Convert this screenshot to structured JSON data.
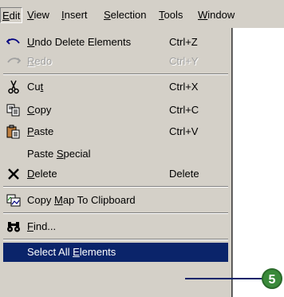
{
  "menubar": {
    "items": [
      {
        "pre": "",
        "u": "E",
        "post": "dit"
      },
      {
        "pre": "",
        "u": "V",
        "post": "iew"
      },
      {
        "pre": "",
        "u": "I",
        "post": "nsert"
      },
      {
        "pre": "",
        "u": "S",
        "post": "election"
      },
      {
        "pre": "",
        "u": "T",
        "post": "ools"
      },
      {
        "pre": "",
        "u": "W",
        "post": "indow"
      }
    ]
  },
  "menu": {
    "items": [
      {
        "icon": "undo-icon",
        "pre": "",
        "u": "U",
        "post": "ndo Delete Elements",
        "shortcut": "Ctrl+Z"
      },
      {
        "icon": "redo-icon",
        "pre": "",
        "u": "R",
        "post": "edo",
        "shortcut": "Ctrl+Y"
      },
      {
        "icon": "scissors-icon",
        "pre": "Cu",
        "u": "t",
        "post": "",
        "shortcut": "Ctrl+X"
      },
      {
        "icon": "copy-icon",
        "pre": "",
        "u": "C",
        "post": "opy",
        "shortcut": "Ctrl+C"
      },
      {
        "icon": "paste-icon",
        "pre": "",
        "u": "P",
        "post": "aste",
        "shortcut": "Ctrl+V"
      },
      {
        "icon": "",
        "pre": "Paste ",
        "u": "S",
        "post": "pecial",
        "shortcut": ""
      },
      {
        "icon": "delete-icon",
        "pre": "",
        "u": "D",
        "post": "elete",
        "shortcut": "Delete"
      },
      {
        "icon": "copy-map-icon",
        "pre": "Copy ",
        "u": "M",
        "post": "ap To Clipboard",
        "shortcut": ""
      },
      {
        "icon": "binoculars-icon",
        "pre": "",
        "u": "F",
        "post": "ind...",
        "shortcut": ""
      },
      {
        "icon": "",
        "pre": "Select All ",
        "u": "E",
        "post": "lements",
        "shortcut": ""
      }
    ]
  },
  "callout": {
    "number": "5"
  },
  "colors": {
    "highlight": "#0a246a",
    "menu_bg": "#d4d0c8",
    "callout": "#3a8a3a"
  }
}
